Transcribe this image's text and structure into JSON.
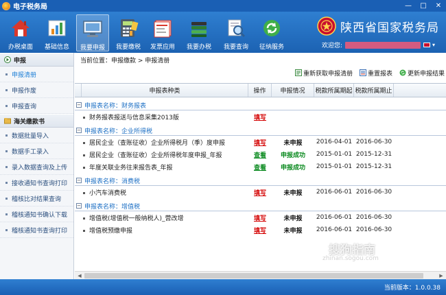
{
  "window": {
    "title": "电子税务局"
  },
  "header": {
    "nav": [
      {
        "label": "办税桌面",
        "icon": "home-icon"
      },
      {
        "label": "基础信息",
        "icon": "chart-icon"
      },
      {
        "label": "我要申报",
        "icon": "monitor-icon",
        "active": true
      },
      {
        "label": "我要缴税",
        "icon": "calculator-icon"
      },
      {
        "label": "发票应用",
        "icon": "invoice-icon"
      },
      {
        "label": "我要办税",
        "icon": "books-icon"
      },
      {
        "label": "我要查询",
        "icon": "magnifier-document-icon"
      },
      {
        "label": "征纳服务",
        "icon": "refresh-icon"
      }
    ],
    "province": "陕西省国家税务局",
    "welcome": "欢迎您:"
  },
  "sidebar": {
    "groups": [
      {
        "title": "申报",
        "items": [
          "申报清册",
          "申报作废",
          "申报查询"
        ],
        "active": "申报清册"
      },
      {
        "title": "海关缴款书",
        "items": [
          "数据批量导入",
          "数据手工录入",
          "录入数据查询及上传",
          "接收通知书查询打印",
          "稽核比对结果查询",
          "稽核通知书确认下载",
          "稽核通知书查询打印"
        ]
      }
    ]
  },
  "main": {
    "breadcrumb": "当前位置：申报缴款 > 申报清册",
    "toolbar": [
      {
        "label": "重新获取申报清册",
        "icon": "reload-list-icon"
      },
      {
        "label": "重置报表",
        "icon": "reset-report-icon"
      },
      {
        "label": "更新申报结果",
        "icon": "update-result-icon"
      }
    ],
    "columns": [
      "申报表种类",
      "操作",
      "申报情况",
      "税款所属期起",
      "税款所属期止"
    ],
    "sections": [
      {
        "title": "申报表名称：财务报表",
        "rows": [
          {
            "name": "财务报表报送与信息采集2013版",
            "op": "填写",
            "status": "",
            "from": "",
            "to": ""
          }
        ]
      },
      {
        "title": "申报表名称：企业所得税",
        "rows": [
          {
            "name": "居民企业（查账征收）企业所得税月（季）度申报",
            "op": "填写",
            "status": "未申报",
            "from": "2016-04-01",
            "to": "2016-06-30"
          },
          {
            "name": "居民企业（查账征收）企业所得税年度申报_年报",
            "op": "查看",
            "status": "申报成功",
            "from": "2015-01-01",
            "to": "2015-12-31"
          },
          {
            "name": "年度关联业务往来报告表_年报",
            "op": "查看",
            "status": "申报成功",
            "from": "2015-01-01",
            "to": "2015-12-31"
          }
        ]
      },
      {
        "title": "申报表名称：消费税",
        "rows": [
          {
            "name": "小汽车消费税",
            "op": "填写",
            "status": "未申报",
            "from": "2016-06-01",
            "to": "2016-06-30"
          }
        ]
      },
      {
        "title": "申报表名称：增值税",
        "rows": [
          {
            "name": "增值税(增值税一般纳税人)_营改增",
            "op": "填写",
            "status": "未申报",
            "from": "2016-06-01",
            "to": "2016-06-30"
          },
          {
            "name": "增值税预缴申报",
            "op": "填写",
            "status": "未申报",
            "from": "2016-06-01",
            "to": "2016-06-30"
          }
        ]
      }
    ]
  },
  "statusbar": {
    "version": "当前版本：1.0.0.38"
  },
  "watermark": {
    "text": "搜狗指南",
    "sub": "zhinan.sogou.com"
  },
  "colors": {
    "header_blue": "#1c62b2",
    "link_red": "#d40000",
    "link_green": "#0a8a1f",
    "section_blue": "#1c6fc4"
  }
}
